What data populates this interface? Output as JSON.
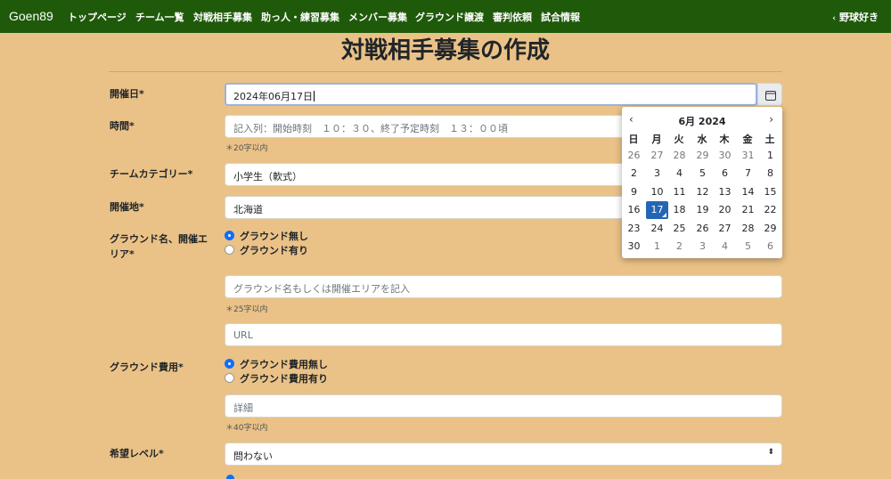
{
  "nav": {
    "brand": "Goen89",
    "items": [
      {
        "label": "トップページ"
      },
      {
        "label": "チーム一覧"
      },
      {
        "label": "対戦相手募集"
      },
      {
        "label": "助っ人・練習募集"
      },
      {
        "label": "メンバー募集"
      },
      {
        "label": "グラウンド譲渡"
      },
      {
        "label": "審判依頼"
      },
      {
        "label": "試合情報"
      }
    ],
    "user": "野球好き",
    "user_chevron": "‹"
  },
  "page": {
    "title": "対戦相手募集の作成"
  },
  "form": {
    "date": {
      "label": "開催日*",
      "value": "2024年06月17日"
    },
    "time": {
      "label": "時間*",
      "placeholder": "記入列：開始時刻　１０：３０、終了予定時刻　１３：００頃",
      "hint": "＊20字以内"
    },
    "category": {
      "label": "チームカテゴリー*",
      "value": "小学生（軟式）"
    },
    "location": {
      "label": "開催地*",
      "value": "北海道"
    },
    "ground": {
      "label_line1": "グラウンド名、開催エ",
      "label_line2": "リア*",
      "options": [
        {
          "label": "グラウンド無し",
          "checked": true
        },
        {
          "label": "グラウンド有り",
          "checked": false
        }
      ],
      "name_placeholder": "グラウンド名もしくは開催エリアを記入",
      "hint": "＊25字以内",
      "url_placeholder": "URL"
    },
    "fee": {
      "label": "グラウンド費用*",
      "options": [
        {
          "label": "グラウンド費用無し",
          "checked": true
        },
        {
          "label": "グラウンド費用有り",
          "checked": false
        }
      ],
      "detail_placeholder": "詳細",
      "hint": "＊40字以内"
    },
    "level": {
      "label": "希望レベル*",
      "value": "問わない"
    }
  },
  "calendar": {
    "month_label": "6月 2024",
    "weekdays": [
      "日",
      "月",
      "火",
      "水",
      "木",
      "金",
      "土"
    ],
    "weeks": [
      [
        "26",
        "27",
        "28",
        "29",
        "30",
        "31",
        "1"
      ],
      [
        "2",
        "3",
        "4",
        "5",
        "6",
        "7",
        "8"
      ],
      [
        "9",
        "10",
        "11",
        "12",
        "13",
        "14",
        "15"
      ],
      [
        "16",
        "17",
        "18",
        "19",
        "20",
        "21",
        "22"
      ],
      [
        "23",
        "24",
        "25",
        "26",
        "27",
        "28",
        "29"
      ],
      [
        "30",
        "1",
        "2",
        "3",
        "4",
        "5",
        "6"
      ]
    ],
    "selected": "17"
  }
}
